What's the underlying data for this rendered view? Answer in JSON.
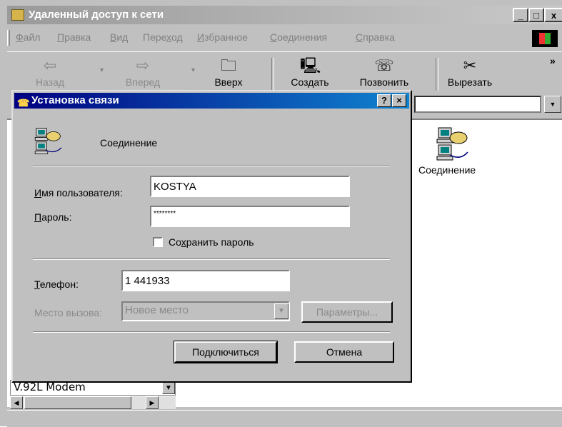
{
  "explorer": {
    "title": "Удаленный доступ к сети",
    "menu": [
      {
        "pre": "",
        "u": "Ф",
        "post": "айл"
      },
      {
        "pre": "",
        "u": "П",
        "post": "равка"
      },
      {
        "pre": "",
        "u": "В",
        "post": "ид"
      },
      {
        "pre": "Пере",
        "u": "х",
        "post": "од"
      },
      {
        "pre": "",
        "u": "И",
        "post": "збранное"
      },
      {
        "pre": "",
        "u": "С",
        "post": "оединения"
      },
      {
        "pre": "",
        "u": "С",
        "post": "правка"
      }
    ],
    "toolbar": {
      "back": "Назад",
      "forward": "Вперед",
      "up": "Вверх",
      "create": "Создать",
      "call": "Позвонить",
      "cut": "Вырезать",
      "more": "»"
    },
    "content": {
      "icon_label": "Соединение",
      "modem": "V.92L Modem"
    }
  },
  "dialog": {
    "title": "Установка связи",
    "connection_name": "Соединение",
    "username_label": {
      "pre": "",
      "u": "И",
      "post": "мя пользователя:"
    },
    "username_value": "KOSTYA",
    "password_label": {
      "pre": "",
      "u": "П",
      "post": "ароль:"
    },
    "password_value": "********",
    "save_password": {
      "pre": "Со",
      "u": "х",
      "post": "ранить пароль"
    },
    "phone_label": {
      "pre": "",
      "u": "Т",
      "post": "елефон:"
    },
    "phone_value": "1 441933",
    "location_label": "Место вызова:",
    "location_value": "Новое место",
    "params_button": "Параметры...",
    "connect_button": "Подключиться",
    "cancel_button": "Отмена",
    "help_button": "?",
    "close_button": "×"
  }
}
